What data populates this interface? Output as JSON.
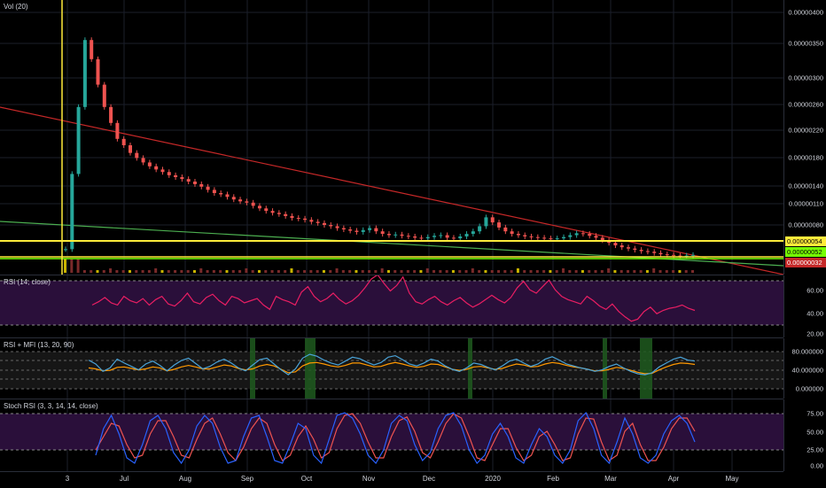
{
  "colors": {
    "background": "#000000",
    "grid": "#1b1f2a",
    "up": "#26a69a",
    "down": "#ef5350",
    "trendline_red": "#c62828",
    "trendline_green": "#4caf50",
    "support_yellow": "#ffeb3b",
    "support_green": "#76ff03",
    "rsi_line": "#e91e63",
    "band_fill": "#2a0f3a",
    "mfi_line": "#4aa3d8",
    "rsi_mfi_orange": "#ff9800",
    "stoch_k": "#2962ff",
    "stoch_d": "#ef5350"
  },
  "main": {
    "legend": "Vol (20)",
    "axis_ticks": [
      "0.00000400",
      "0.00000350",
      "0.00000300",
      "0.00000260",
      "0.00000220",
      "0.00000180",
      "0.00000140",
      "0.00000110",
      "0.00000080"
    ],
    "price_tags": {
      "yellow": "0.00000054",
      "green": "0.00000052",
      "red": "0.00000032"
    },
    "candles": [
      5.2,
      17.0,
      27.5,
      38.0,
      35.0,
      31.0,
      27.5,
      25.0,
      22.5,
      21.5,
      20.3,
      19.5,
      18.8,
      18.2,
      17.7,
      17.3,
      16.8,
      16.5,
      16.2,
      15.8,
      15.4,
      15.0,
      14.5,
      14.0,
      13.8,
      13.4,
      13.0,
      12.7,
      12.5,
      12.0,
      11.6,
      11.2,
      10.9,
      10.7,
      10.4,
      10.1,
      10.0,
      9.8,
      9.5,
      9.3,
      9.0,
      8.8,
      8.5,
      8.3,
      8.1,
      7.9,
      8.2,
      8.5,
      8.0,
      7.6,
      7.4,
      7.5,
      7.3,
      7.2,
      7.0,
      6.9,
      7.1,
      7.3,
      7.4,
      7.0,
      6.9,
      7.2,
      7.6,
      8.0,
      8.8,
      10.2,
      9.4,
      8.6,
      8.0,
      7.6,
      7.4,
      7.2,
      7.1,
      7.0,
      6.9,
      6.8,
      6.9,
      7.1,
      7.4,
      7.7,
      7.6,
      7.3,
      7.0,
      6.6,
      6.2,
      5.8,
      5.5,
      5.3,
      5.1,
      4.9,
      4.8,
      4.6,
      4.4,
      4.3,
      4.2,
      4.1,
      4.2,
      4.3
    ]
  },
  "rsi": {
    "legend": "RSI (14, close)",
    "axis_ticks": [
      "60.00",
      "40.00",
      "20.00"
    ],
    "values": [
      44,
      47,
      51,
      46,
      44,
      52,
      48,
      46,
      50,
      44,
      49,
      52,
      45,
      43,
      48,
      55,
      47,
      45,
      51,
      54,
      48,
      44,
      52,
      50,
      46,
      48,
      50,
      44,
      40,
      52,
      49,
      47,
      44,
      56,
      61,
      52,
      47,
      50,
      55,
      49,
      45,
      48,
      53,
      60,
      68,
      72,
      64,
      57,
      62,
      70,
      55,
      47,
      45,
      49,
      52,
      47,
      44,
      48,
      51,
      46,
      42,
      45,
      49,
      53,
      49,
      46,
      51,
      60,
      66,
      58,
      55,
      61,
      67,
      58,
      52,
      49,
      47,
      45,
      52,
      48,
      43,
      40,
      45,
      38,
      33,
      29,
      31,
      38,
      42,
      36,
      39,
      41,
      42,
      44,
      41,
      39
    ]
  },
  "rsi_mfi": {
    "legend": "RSI + MFI (13, 20, 90)",
    "axis_ticks": [
      "80.000000",
      "40.000000",
      "0.000000"
    ],
    "mfi": [
      68,
      60,
      45,
      52,
      70,
      62,
      55,
      48,
      60,
      66,
      57,
      46,
      58,
      67,
      72,
      61,
      50,
      55,
      64,
      70,
      62,
      52,
      46,
      58,
      69,
      72,
      60,
      48,
      38,
      50,
      72,
      80,
      76,
      68,
      62,
      58,
      66,
      74,
      71,
      64,
      58,
      63,
      74,
      77,
      69,
      60,
      56,
      62,
      70,
      66,
      56,
      49,
      45,
      52,
      62,
      59,
      53,
      48,
      56,
      66,
      70,
      62,
      55,
      60,
      70,
      75,
      68,
      60,
      56,
      52,
      49,
      45,
      48,
      55,
      60,
      52,
      45,
      40,
      38,
      42,
      54,
      62,
      70,
      74,
      68,
      66
    ],
    "orange": [
      52,
      50,
      46,
      47,
      53,
      54,
      51,
      48,
      50,
      54,
      52,
      46,
      49,
      54,
      57,
      54,
      50,
      50,
      54,
      58,
      56,
      51,
      48,
      50,
      56,
      59,
      56,
      49,
      42,
      44,
      56,
      62,
      63,
      60,
      56,
      54,
      57,
      62,
      62,
      58,
      54,
      55,
      60,
      63,
      60,
      56,
      53,
      55,
      60,
      59,
      54,
      49,
      47,
      49,
      54,
      55,
      52,
      49,
      51,
      56,
      60,
      58,
      54,
      55,
      60,
      63,
      61,
      57,
      54,
      52,
      49,
      46,
      46,
      49,
      53,
      51,
      47,
      43,
      40,
      41,
      48,
      54,
      59,
      62,
      61,
      59
    ]
  },
  "stoch": {
    "legend": "Stoch RSI (3, 3, 14, 14, close)",
    "axis_ticks": [
      "75.00",
      "50.00",
      "25.00",
      "0.00"
    ],
    "k": [
      20,
      70,
      95,
      60,
      15,
      5,
      40,
      85,
      95,
      70,
      25,
      5,
      30,
      75,
      95,
      80,
      35,
      5,
      10,
      55,
      90,
      95,
      55,
      10,
      5,
      40,
      80,
      70,
      20,
      5,
      50,
      95,
      100,
      90,
      60,
      20,
      5,
      30,
      80,
      95,
      85,
      40,
      10,
      25,
      70,
      95,
      100,
      75,
      30,
      5,
      20,
      60,
      80,
      55,
      15,
      5,
      40,
      70,
      55,
      20,
      5,
      30,
      85,
      100,
      70,
      20,
      5,
      45,
      90,
      60,
      15,
      5,
      20,
      60,
      85,
      95,
      80,
      45
    ],
    "d": [
      30,
      55,
      80,
      75,
      40,
      15,
      20,
      60,
      85,
      85,
      55,
      20,
      15,
      50,
      80,
      90,
      60,
      25,
      10,
      35,
      70,
      90,
      80,
      40,
      10,
      20,
      55,
      75,
      50,
      15,
      25,
      70,
      95,
      98,
      80,
      45,
      15,
      15,
      55,
      85,
      92,
      65,
      25,
      15,
      45,
      80,
      98,
      90,
      55,
      15,
      10,
      40,
      70,
      70,
      35,
      10,
      20,
      55,
      65,
      40,
      10,
      15,
      60,
      90,
      88,
      45,
      10,
      20,
      65,
      80,
      40,
      10,
      10,
      35,
      70,
      90,
      90,
      65
    ]
  },
  "time_axis": {
    "labels": [
      "3",
      "Jul",
      "Aug",
      "Sep",
      "Oct",
      "Nov",
      "Dec",
      "2020",
      "Feb",
      "Mar",
      "Apr",
      "May"
    ]
  }
}
